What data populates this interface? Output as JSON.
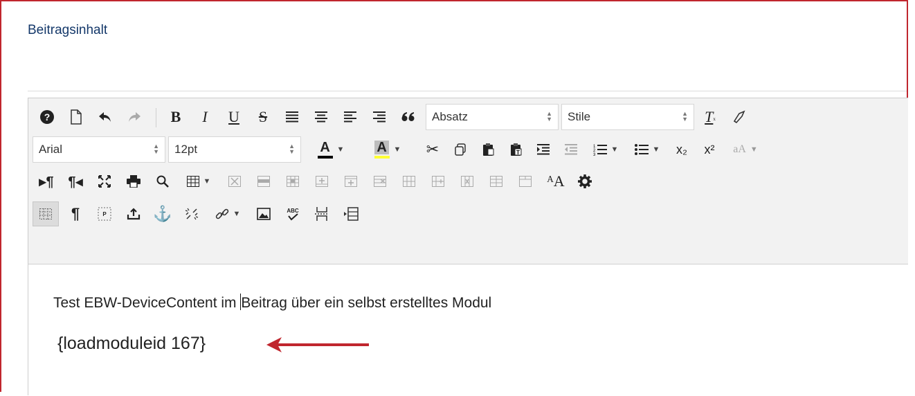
{
  "field": {
    "label": "Beitragsinhalt"
  },
  "toolbar": {
    "format_select": "Absatz",
    "style_select": "Stile",
    "font_select": "Arial",
    "size_select": "12pt",
    "bold": "B",
    "italic": "I",
    "underline": "U",
    "strike": "S",
    "quote": "66",
    "text_color_label": "A",
    "bg_color_label": "A",
    "text_color": "#000000",
    "bg_color": "#ffff33",
    "subscript": "x₂",
    "superscript": "x²",
    "font_size_label": "aA",
    "typography_label": "ᴬA"
  },
  "content": {
    "line1_before_caret": "Test EBW-DeviceContent im ",
    "line1_after_caret": "Beitrag über ein selbst erstelltes Modul",
    "line2": "{loadmoduleid 167}"
  },
  "colors": {
    "frame_border": "#c0262e",
    "arrow": "#c0262e",
    "label": "#14386a"
  }
}
